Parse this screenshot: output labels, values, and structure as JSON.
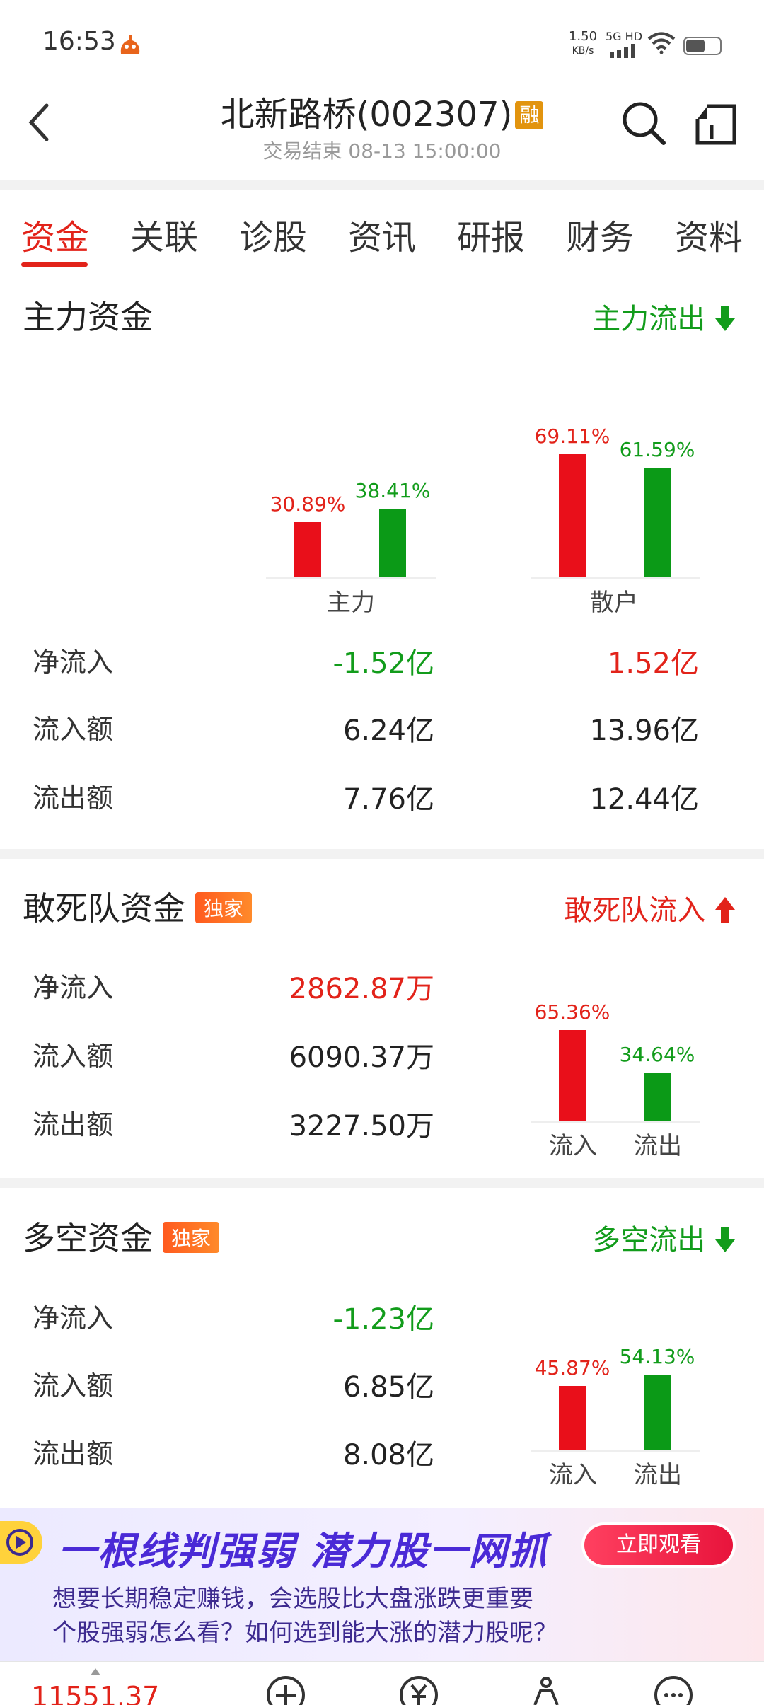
{
  "status_bar": {
    "time": "16:53",
    "speed_value": "1.50",
    "speed_unit": "KB/s",
    "network": "5G HD"
  },
  "header": {
    "title": "北新路桥(002307)",
    "margin_badge": "融",
    "subtitle": "交易结束 08-13 15:00:00"
  },
  "tabs": [
    {
      "label": "资金",
      "active": true
    },
    {
      "label": "关联",
      "active": false
    },
    {
      "label": "诊股",
      "active": false
    },
    {
      "label": "资讯",
      "active": false
    },
    {
      "label": "研报",
      "active": false
    },
    {
      "label": "财务",
      "active": false
    },
    {
      "label": "资料",
      "active": false
    }
  ],
  "main_fund": {
    "title": "主力资金",
    "flow_tag": "主力流出",
    "rows": [
      {
        "label": "净流入",
        "main": "-1.52亿",
        "retail": "1.52亿"
      },
      {
        "label": "流入额",
        "main": "6.24亿",
        "retail": "13.96亿"
      },
      {
        "label": "流出额",
        "main": "7.76亿",
        "retail": "12.44亿"
      }
    ]
  },
  "dare_fund": {
    "title": "敢死队资金",
    "badge": "独家",
    "flow_tag": "敢死队流入",
    "rows": [
      {
        "label": "净流入",
        "value": "2862.87万"
      },
      {
        "label": "流入额",
        "value": "6090.37万"
      },
      {
        "label": "流出额",
        "value": "3227.50万"
      }
    ]
  },
  "longshort_fund": {
    "title": "多空资金",
    "badge": "独家",
    "flow_tag": "多空流出",
    "rows": [
      {
        "label": "净流入",
        "value": "-1.23亿"
      },
      {
        "label": "流入额",
        "value": "6.85亿"
      },
      {
        "label": "流出额",
        "value": "8.08亿"
      }
    ]
  },
  "chart_data": [
    {
      "type": "bar",
      "categories": [
        "主力",
        "散户"
      ],
      "series": [
        {
          "values": [
            30.89,
            69.11
          ],
          "labels": [
            "30.89%",
            "69.11%"
          ],
          "color": "#e90f1a"
        },
        {
          "values": [
            38.41,
            61.59
          ],
          "labels": [
            "38.41%",
            "61.59%"
          ],
          "color": "#0b9a17"
        }
      ],
      "ylim": [
        0,
        100
      ]
    },
    {
      "type": "bar",
      "categories": [
        "流入",
        "流出"
      ],
      "values": [
        65.36,
        34.64
      ],
      "labels": [
        "65.36%",
        "34.64%"
      ],
      "colors": [
        "#e90f1a",
        "#0b9a17"
      ],
      "ylim": [
        0,
        100
      ]
    },
    {
      "type": "bar",
      "categories": [
        "流入",
        "流出"
      ],
      "values": [
        45.87,
        54.13
      ],
      "labels": [
        "45.87%",
        "54.13%"
      ],
      "colors": [
        "#e90f1a",
        "#0b9a17"
      ],
      "ylim": [
        0,
        100
      ]
    }
  ],
  "banner": {
    "headline": "一根线判强弱 潜力股一网抓",
    "button": "立即观看",
    "line1": "想要长期稳定赚钱，会选股比大盘涨跌更重要",
    "line2": "个股强弱怎么看？如何选到能大涨的潜力股呢？"
  },
  "bottom_bar": {
    "index_value": "11551.37"
  },
  "colors": {
    "red": "#e2231a",
    "green": "#129c1b",
    "accent_badge": "#e2940e"
  }
}
